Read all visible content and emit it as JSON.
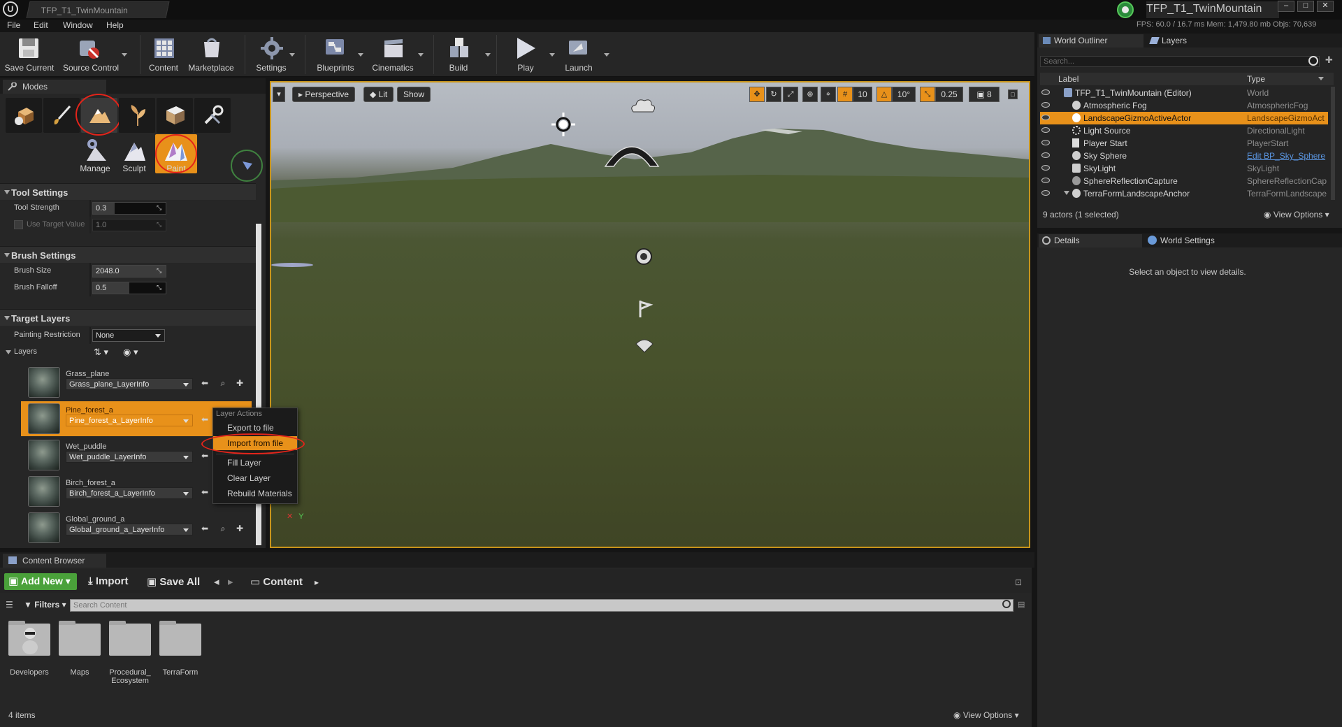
{
  "window": {
    "tab_title": "TFP_T1_TwinMountain",
    "project_name": "TFP_T1_TwinMountain",
    "perf": "FPS: 60.0  / 16.7 ms  Mem: 1,479.80 mb  Objs: 70,639"
  },
  "menu": [
    "File",
    "Edit",
    "Window",
    "Help"
  ],
  "toolbar": {
    "save_current": "Save Current",
    "source_control": "Source Control",
    "content": "Content",
    "marketplace": "Marketplace",
    "settings": "Settings",
    "blueprints": "Blueprints",
    "cinematics": "Cinematics",
    "build": "Build",
    "play": "Play",
    "launch": "Launch"
  },
  "modes": {
    "tab": "Modes",
    "sub": {
      "manage": "Manage",
      "sculpt": "Sculpt",
      "paint": "Paint"
    },
    "tool_settings": {
      "header": "Tool Settings",
      "tool_strength_label": "Tool Strength",
      "tool_strength_value": "0.3",
      "tool_strength_fraction": 0.3,
      "use_target_label": "Use Target Value",
      "use_target_value": "1.0"
    },
    "brush_settings": {
      "header": "Brush Settings",
      "brush_size_label": "Brush Size",
      "brush_size_value": "2048.0",
      "brush_falloff_label": "Brush Falloff",
      "brush_falloff_value": "0.5",
      "brush_falloff_fraction": 0.5
    },
    "target_layers": {
      "header": "Target Layers",
      "painting_restriction_label": "Painting Restriction",
      "painting_restriction_value": "None",
      "layers_label": "Layers",
      "layers": [
        {
          "name": "Grass_plane",
          "info": "Grass_plane_LayerInfo"
        },
        {
          "name": "Pine_forest_a",
          "info": "Pine_forest_a_LayerInfo"
        },
        {
          "name": "Wet_puddle",
          "info": "Wet_puddle_LayerInfo"
        },
        {
          "name": "Birch_forest_a",
          "info": "Birch_forest_a_LayerInfo"
        },
        {
          "name": "Global_ground_a",
          "info": "Global_ground_a_LayerInfo"
        }
      ]
    }
  },
  "context_menu": {
    "header": "Layer Actions",
    "items": [
      "Export to file",
      "Import from file",
      "Fill Layer",
      "Clear Layer",
      "Rebuild Materials"
    ]
  },
  "viewport": {
    "perspective": "Perspective",
    "lit": "Lit",
    "show": "Show",
    "grid_snap": "10",
    "rot_snap": "10°",
    "scale_snap": "0.25",
    "cam_speed": "8"
  },
  "outliner": {
    "tab": "World Outliner",
    "layers_tab": "Layers",
    "search_placeholder": "Search...",
    "col_label": "Label",
    "col_type": "Type",
    "rows": [
      {
        "label": "TFP_T1_TwinMountain (Editor)",
        "type": "World"
      },
      {
        "label": "Atmospheric Fog",
        "type": "AtmosphericFog"
      },
      {
        "label": "LandscapeGizmoActiveActor",
        "type": "LandscapeGizmoAct"
      },
      {
        "label": "Light Source",
        "type": "DirectionalLight"
      },
      {
        "label": "Player Start",
        "type": "PlayerStart"
      },
      {
        "label": "Sky Sphere",
        "type": "Edit BP_Sky_Sphere"
      },
      {
        "label": "SkyLight",
        "type": "SkyLight"
      },
      {
        "label": "SphereReflectionCapture",
        "type": "SphereReflectionCap"
      },
      {
        "label": "TerraFormLandscapeAnchor",
        "type": "TerraFormLandscape"
      }
    ],
    "status": "9 actors (1 selected)",
    "view_options": "View Options"
  },
  "details": {
    "tab": "Details",
    "world_settings_tab": "World Settings",
    "empty_message": "Select an object to view details."
  },
  "content_browser": {
    "tab": "Content Browser",
    "add_new": "Add New",
    "import": "Import",
    "save_all": "Save All",
    "path": "Content",
    "filters": "Filters",
    "search_placeholder": "Search Content",
    "folders": [
      "Developers",
      "Maps",
      "Procedural_ Ecosystem",
      "TerraForm"
    ],
    "item_count": "4 items",
    "view_options": "View Options"
  },
  "colors": {
    "accent": "#e8911a",
    "highlight_ring": "#e3241a",
    "add_new": "#4aa13a"
  }
}
